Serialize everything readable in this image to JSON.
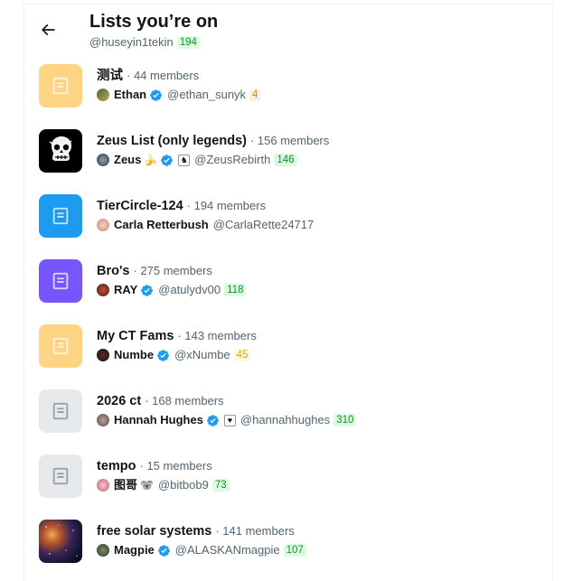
{
  "header": {
    "title": "Lists you’re on",
    "handle": "@huseyin1tekin",
    "handle_count": "194"
  },
  "colors": {
    "accent": "#1d9bf0",
    "text_primary": "#0f1419",
    "text_secondary": "#536471",
    "badge_green_bg": "#dcfce0",
    "badge_green_fg": "#1a8a35"
  },
  "lists": [
    {
      "name": "测试",
      "members": "· 44 members",
      "thumb": "list-icon-yellow",
      "owner": {
        "name": "Ethan",
        "verified": true,
        "handle": "@ethan_sunyk",
        "count": "4",
        "count_color": "orange"
      }
    },
    {
      "name": "Zeus List (only legends)",
      "members": "· 156 members",
      "thumb": "skull-ape-image",
      "owner": {
        "name": "Zeus",
        "emoji": "🍌",
        "verified": true,
        "box": "♞",
        "handle": "@ZeusRebirth",
        "count": "146",
        "count_color": "green"
      }
    },
    {
      "name": "TierCircle-124",
      "members": "· 194 members",
      "thumb": "list-icon-blue",
      "owner": {
        "name": "Carla Retterbush",
        "verified": false,
        "handle": "@CarlaRette24717",
        "count": "",
        "count_color": ""
      }
    },
    {
      "name": "Bro's",
      "members": "· 275 members",
      "thumb": "list-icon-purple",
      "owner": {
        "name": "RAY",
        "verified": true,
        "handle": "@atulydv00",
        "count": "118",
        "count_color": "green"
      }
    },
    {
      "name": "My CT Fams",
      "members": "· 143 members",
      "thumb": "list-icon-yellow",
      "owner": {
        "name": "Numbe",
        "verified": true,
        "handle": "@xNumbe",
        "count": "45",
        "count_color": "yellow"
      }
    },
    {
      "name": "2026 ct",
      "members": "· 168 members",
      "thumb": "list-icon-gray",
      "owner": {
        "name": "Hannah Hughes",
        "verified": true,
        "box": "♥",
        "handle": "@hannahhughes",
        "count": "310",
        "count_color": "green"
      }
    },
    {
      "name": "tempo",
      "members": "· 15 members",
      "thumb": "list-icon-gray",
      "owner": {
        "name": "图哥",
        "emoji": "🐨",
        "verified": false,
        "handle": "@bitbob9",
        "count": "73",
        "count_color": "green"
      }
    },
    {
      "name": "free solar systems",
      "members": "· 141 members",
      "thumb": "space-image",
      "owner": {
        "name": "Magpie",
        "verified": true,
        "handle": "@ALASKANmagpie",
        "count": "107",
        "count_color": "green"
      }
    }
  ]
}
